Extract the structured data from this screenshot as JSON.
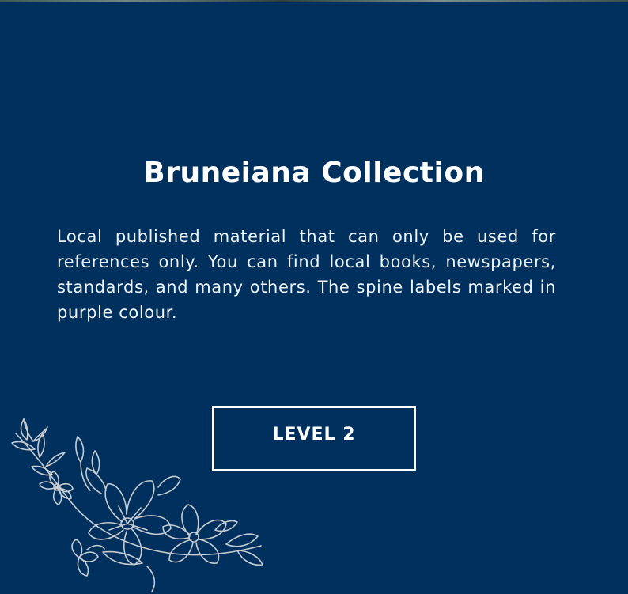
{
  "section": {
    "title": "Bruneiana Collection",
    "description": "Local published material that can only be used for references only. You can find local books, newspapers, standards, and many others. The spine labels marked in purple colour.",
    "button_label": "LEVEL 2"
  },
  "colors": {
    "background": "#00305d",
    "text": "#ffffff",
    "floral_line": "#c9ccd2"
  },
  "icons": {
    "decoration": "floral-line-art-icon"
  }
}
